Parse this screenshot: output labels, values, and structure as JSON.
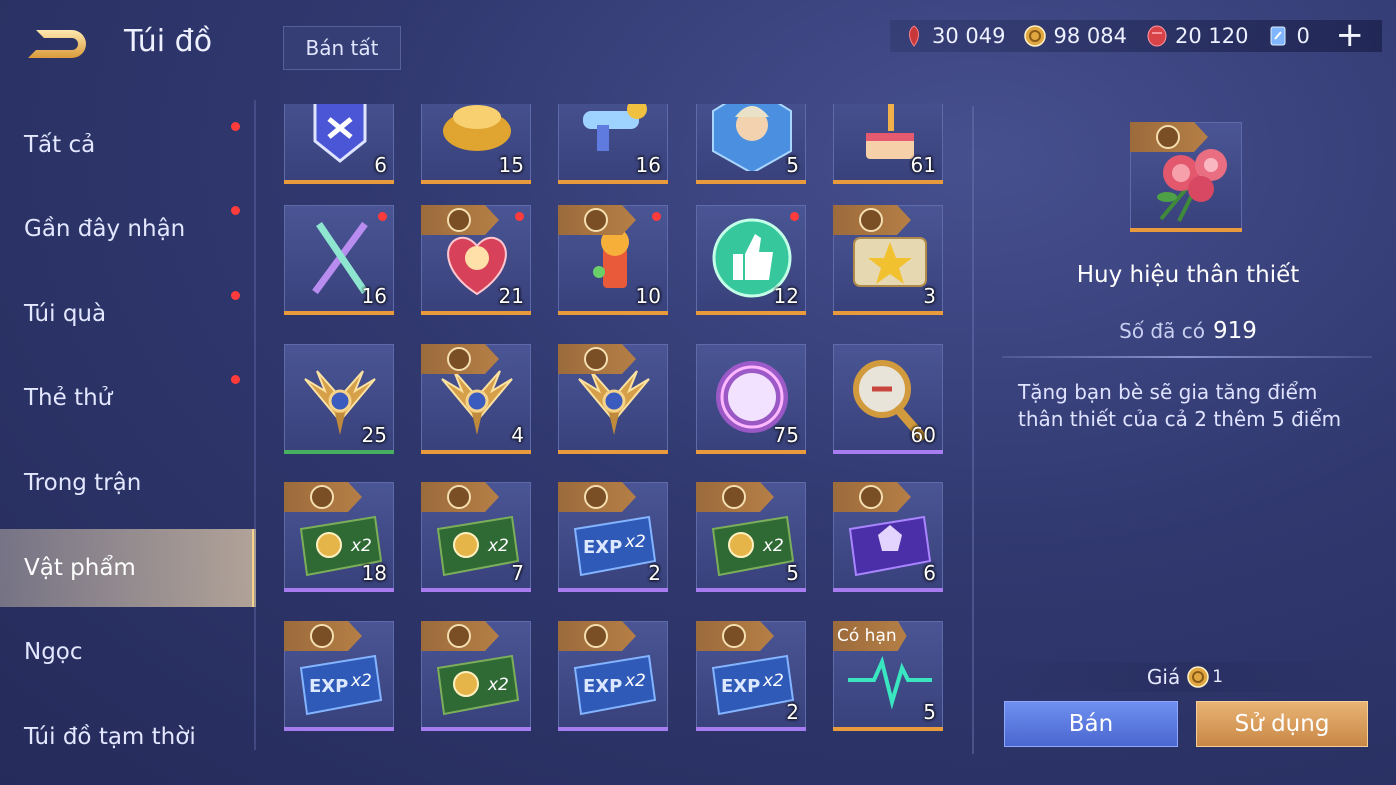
{
  "header": {
    "title": "Túi đồ",
    "sell_all_label": "Bán tất",
    "plus_label": "+",
    "currencies": [
      {
        "icon": "red-voucher-icon",
        "value": "30 049",
        "color": "#c8373a"
      },
      {
        "icon": "gold-coin-icon",
        "value": "98 084",
        "color": "#e0a740"
      },
      {
        "icon": "ruby-gem-icon",
        "value": "20 120",
        "color": "#d8434a"
      },
      {
        "icon": "blue-crystal-icon",
        "value": "0",
        "color": "#7fb6ff"
      }
    ]
  },
  "sidebar": {
    "items": [
      {
        "label": "Tất cả",
        "dot": true,
        "active": false
      },
      {
        "label": "Gần đây nhận",
        "dot": true,
        "active": false
      },
      {
        "label": "Túi quà",
        "dot": true,
        "active": false
      },
      {
        "label": "Thẻ thử",
        "dot": true,
        "active": false
      },
      {
        "label": "Trong trận",
        "dot": false,
        "active": false
      },
      {
        "label": "Vật phẩm",
        "dot": false,
        "active": true
      },
      {
        "label": "Ngọc",
        "dot": false,
        "active": false
      },
      {
        "label": "Túi đồ tạm thời",
        "dot": false,
        "active": false
      }
    ]
  },
  "grid": {
    "items": [
      {
        "icon": "blue-shield-emblem-icon",
        "qty": "6",
        "ribbon": false,
        "dot": false,
        "bar": "orange"
      },
      {
        "icon": "gold-ingot-icon",
        "qty": "15",
        "ribbon": false,
        "dot": false,
        "bar": "orange"
      },
      {
        "icon": "toy-blaster-icon",
        "qty": "16",
        "ribbon": false,
        "dot": false,
        "bar": "orange"
      },
      {
        "icon": "hero-portrait-card-icon",
        "qty": "5",
        "ribbon": false,
        "dot": false,
        "bar": "orange"
      },
      {
        "icon": "birthday-cake-icon",
        "qty": "61",
        "ribbon": false,
        "dot": false,
        "bar": "orange"
      },
      {
        "icon": "crossed-swords-icon",
        "qty": "16",
        "ribbon": false,
        "dot": true,
        "bar": "orange"
      },
      {
        "icon": "heart-gift-box-icon",
        "qty": "21",
        "ribbon": true,
        "dot": true,
        "bar": "orange"
      },
      {
        "icon": "firework-bouquet-icon",
        "qty": "10",
        "ribbon": true,
        "dot": true,
        "bar": "orange"
      },
      {
        "icon": "thumbs-up-icon",
        "qty": "12",
        "ribbon": false,
        "dot": true,
        "bar": "orange"
      },
      {
        "icon": "star-ticket-icon",
        "qty": "3",
        "ribbon": true,
        "dot": false,
        "bar": "orange"
      },
      {
        "icon": "winged-emblem-icon",
        "qty": "25",
        "ribbon": false,
        "dot": false,
        "bar": "green"
      },
      {
        "icon": "winged-emblem-icon",
        "qty": "4",
        "ribbon": true,
        "dot": false,
        "bar": "orange"
      },
      {
        "icon": "winged-emblem-icon",
        "qty": "",
        "ribbon": true,
        "dot": false,
        "bar": "orange"
      },
      {
        "icon": "glowing-orb-icon",
        "qty": "75",
        "ribbon": false,
        "dot": false,
        "bar": "orange"
      },
      {
        "icon": "golden-scepter-icon",
        "qty": "60",
        "ribbon": false,
        "dot": false,
        "bar": "purple"
      },
      {
        "icon": "gold-x2-card-icon",
        "qty": "18",
        "ribbon": true,
        "dot": false,
        "bar": "purple"
      },
      {
        "icon": "gold-x2-card-icon",
        "qty": "7",
        "ribbon": true,
        "dot": false,
        "bar": "purple"
      },
      {
        "icon": "exp-x2-card-icon",
        "qty": "2",
        "ribbon": true,
        "dot": false,
        "bar": "purple"
      },
      {
        "icon": "gold-x2-card-icon",
        "qty": "5",
        "ribbon": true,
        "dot": false,
        "bar": "purple"
      },
      {
        "icon": "purple-emblem-card-icon",
        "qty": "6",
        "ribbon": true,
        "dot": false,
        "bar": "purple"
      },
      {
        "icon": "exp-x2-card-icon",
        "qty": "",
        "ribbon": true,
        "dot": false,
        "bar": "purple"
      },
      {
        "icon": "gold-x2-card-icon",
        "qty": "",
        "ribbon": true,
        "dot": false,
        "bar": "purple"
      },
      {
        "icon": "exp-x2-card-icon",
        "qty": "",
        "ribbon": true,
        "dot": false,
        "bar": "purple"
      },
      {
        "icon": "exp-x2-card-icon",
        "qty": "2",
        "ribbon": true,
        "dot": false,
        "bar": "purple"
      },
      {
        "icon": "heartbeat-line-icon",
        "qty": "5",
        "ribbon": false,
        "limit": "Có hạn",
        "dot": false,
        "bar": "orange"
      }
    ]
  },
  "detail": {
    "icon": "rose-bouquet-icon",
    "name": "Huy hiệu thân thiết",
    "owned_label": "Số đã có",
    "owned_value": "919",
    "description": "Tặng bạn bè sẽ gia tăng điểm thân thiết của cả 2 thêm 5 điểm",
    "price_label": "Giá",
    "price_value": "1",
    "sell_label": "Bán",
    "use_label": "Sử dụng"
  }
}
